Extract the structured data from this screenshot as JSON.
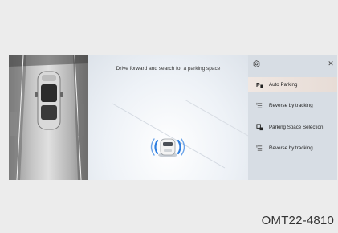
{
  "scene": {
    "instruction": "Drive forward and search for a parking space"
  },
  "menu": {
    "settings_icon": "settings-icon",
    "close_icon": "close-icon",
    "close_glyph": "✕",
    "items": [
      {
        "label": "Auto Parking",
        "icon": "auto-parking-icon",
        "active": true
      },
      {
        "label": "Reverse by tracking",
        "icon": "reverse-tracking-icon",
        "active": false
      },
      {
        "label": "Parking Space Selection",
        "icon": "parking-space-selection-icon",
        "active": false
      },
      {
        "label": "Reverse by tracking",
        "icon": "reverse-tracking-icon",
        "active": false
      }
    ]
  },
  "caption": "OMT22-4810",
  "colors": {
    "active_item": "#efe6e1",
    "radar_blue": "#2f7fe0",
    "menu_bg": "#d7dde4"
  }
}
